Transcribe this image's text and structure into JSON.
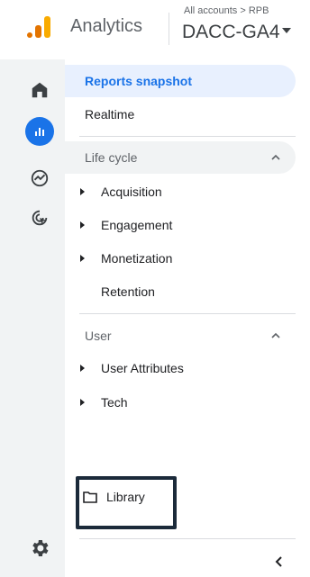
{
  "header": {
    "app_name": "Analytics",
    "breadcrumb": "All accounts > RPB",
    "account": "DACC-GA4"
  },
  "rail": {
    "icons": [
      "home-icon",
      "reports-icon",
      "explore-icon",
      "advertising-icon"
    ],
    "bottom_icon": "gear-icon"
  },
  "nav": {
    "reports_snapshot": "Reports snapshot",
    "realtime": "Realtime",
    "life_cycle": {
      "title": "Life cycle",
      "items": [
        "Acquisition",
        "Engagement",
        "Monetization",
        "Retention"
      ]
    },
    "user": {
      "title": "User",
      "items": [
        "User Attributes",
        "Tech"
      ]
    },
    "library": "Library"
  },
  "colors": {
    "accent": "#1a73e8",
    "active_bg": "#e8f0fe",
    "rail_bg": "#f1f3f4",
    "logo_orange": "#e37400",
    "logo_yellow": "#f9ab00",
    "highlight_box": "#1b2a3a"
  }
}
